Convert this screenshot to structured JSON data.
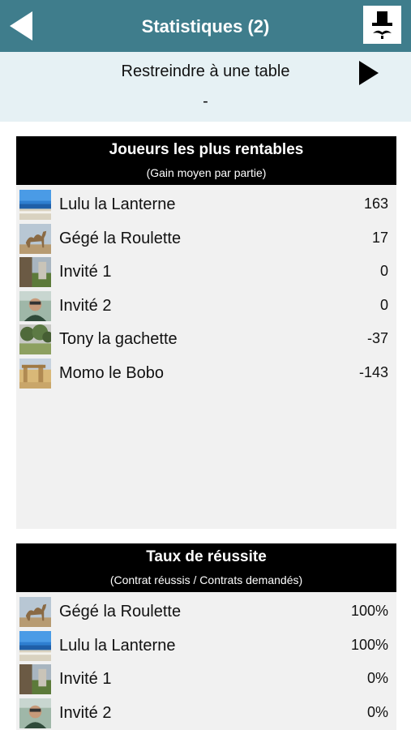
{
  "nav": {
    "title": "Statistiques (2)",
    "back_icon": "back-arrow-icon",
    "hat_icon": "top-hat-mustache-icon",
    "color": "#3f7d8c"
  },
  "filter": {
    "label": "Restreindre à une table",
    "value": "-",
    "play_icon": "play-triangle-icon"
  },
  "profitable": {
    "title": "Joueurs les plus rentables",
    "subtitle": "(Gain moyen par partie)",
    "rows": [
      {
        "name": "Lulu la Lanterne",
        "value": "163",
        "avatar": "beach"
      },
      {
        "name": "Gégé la Roulette",
        "value": "17",
        "avatar": "camel"
      },
      {
        "name": "Invité 1",
        "value": "0",
        "avatar": "cliff"
      },
      {
        "name": "Invité 2",
        "value": "0",
        "avatar": "selfie"
      },
      {
        "name": "Tony la gachette",
        "value": "-37",
        "avatar": "trees"
      },
      {
        "name": "Momo le Bobo",
        "value": "-143",
        "avatar": "ruins"
      }
    ]
  },
  "success": {
    "title": "Taux de réussite",
    "subtitle": "(Contrat réussis / Contrats demandés)",
    "rows": [
      {
        "name": "Gégé la Roulette",
        "value": "100%",
        "avatar": "camel"
      },
      {
        "name": "Lulu la Lanterne",
        "value": "100%",
        "avatar": "beach"
      },
      {
        "name": "Invité 1",
        "value": "0%",
        "avatar": "cliff"
      },
      {
        "name": "Invité 2",
        "value": "0%",
        "avatar": "selfie"
      }
    ]
  }
}
